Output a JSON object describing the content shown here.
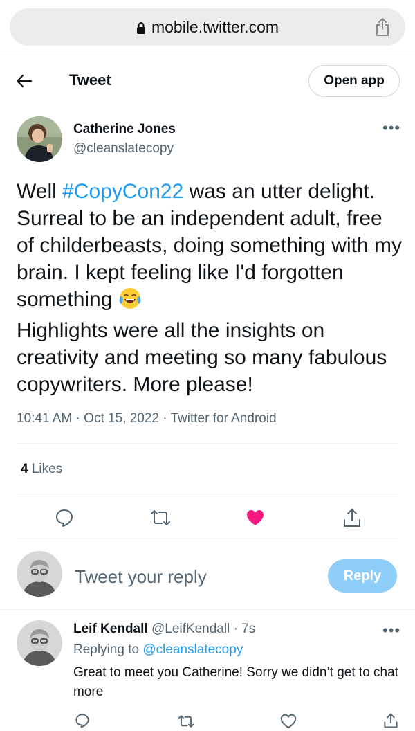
{
  "browser": {
    "url": "mobile.twitter.com"
  },
  "header": {
    "title": "Tweet",
    "open_app": "Open app"
  },
  "tweet": {
    "author_name": "Catherine Jones",
    "author_handle": "@cleanslatecopy",
    "text_before": "Well ",
    "hashtag": "#CopyCon22",
    "text_after": " was an utter delight. Surreal to be an independent adult, free of childerbeasts, doing something with my brain. I kept feeling like I'd forgotten something",
    "text_end": "Highlights were all the insights on creativity and meeting so many fabulous copywriters. More please!",
    "meta": "10:41 AM · Oct 15, 2022 · Twitter for Android",
    "likes_count": "4",
    "likes_label": "Likes",
    "liked_color": "#f91880"
  },
  "composer": {
    "placeholder": "Tweet your reply",
    "button": "Reply"
  },
  "reply": {
    "name": "Leif Kendall",
    "handle": "@LeifKendall",
    "time": "· 7s",
    "replying_label": "Replying to",
    "replying_handle": "@cleanslatecopy",
    "text": "Great to meet you Catherine! Sorry we didn’t get to chat more"
  }
}
